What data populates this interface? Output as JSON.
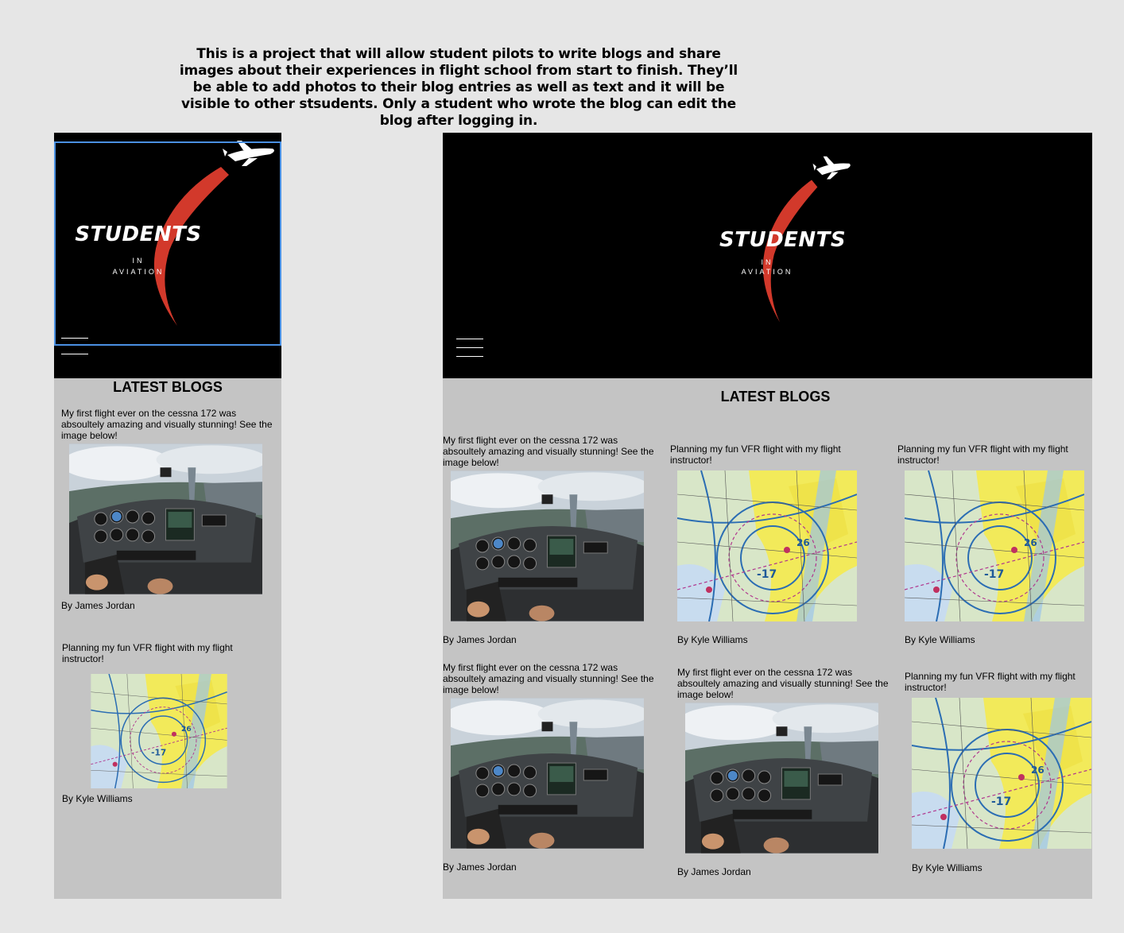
{
  "intro_text": "This is a project that will allow student pilots to write blogs and share images about their experiences in flight school from start to finish. They’ll be able to add photos to their blog entries as well as text and it will be visible to other stsudents. Only a student who wrote the blog can edit the blog after logging in.",
  "logo": {
    "word": "STUDENTS",
    "line1": "IN",
    "line2": "AVIATION"
  },
  "section_title": "LATEST BLOGS",
  "captions": {
    "cessna": "My first flight ever on the cessna 172 was absoultely amazing and visually stunning! See the image below!",
    "vfr": "Planning my fun VFR flight with my flight instructor!"
  },
  "authors": {
    "james": "By James Jordan",
    "kyle": "By Kyle Williams"
  },
  "mobile_posts": [
    {
      "caption": "My first flight ever on the cessna 172 was absoultely amazing and visually stunning! See the image below!",
      "image": "cockpit-photo",
      "author": "By James Jordan"
    },
    {
      "caption": "Planning my fun VFR flight with my flight instructor!",
      "image": "sectional-chart",
      "author": "By Kyle Williams"
    }
  ],
  "desktop_posts": [
    {
      "caption": "My first flight ever on the cessna 172 was absoultely amazing and visually stunning! See the image below!",
      "image": "cockpit-photo",
      "author": "By James Jordan"
    },
    {
      "caption": "Planning my fun VFR flight with my flight instructor!",
      "image": "sectional-chart",
      "author": "By Kyle Williams"
    },
    {
      "caption": "Planning my fun VFR flight with my flight instructor!",
      "image": "sectional-chart",
      "author": "By Kyle Williams"
    },
    {
      "caption": "My first flight ever on the cessna 172 was absoultely amazing and visually stunning! See the image below!",
      "image": "cockpit-photo",
      "author": "By James Jordan"
    },
    {
      "caption": "My first flight ever on the cessna 172 was absoultely amazing and visually stunning! See the image below!",
      "image": "cockpit-photo",
      "author": "By James Jordan"
    },
    {
      "caption": "Planning my fun VFR flight with my flight instructor!",
      "image": "sectional-chart",
      "author": "By Kyle Williams"
    }
  ],
  "colors": {
    "swoosh": "#d2392b",
    "selection": "#4a90e2",
    "header": "#000000",
    "panel": "#c4c4c4"
  }
}
